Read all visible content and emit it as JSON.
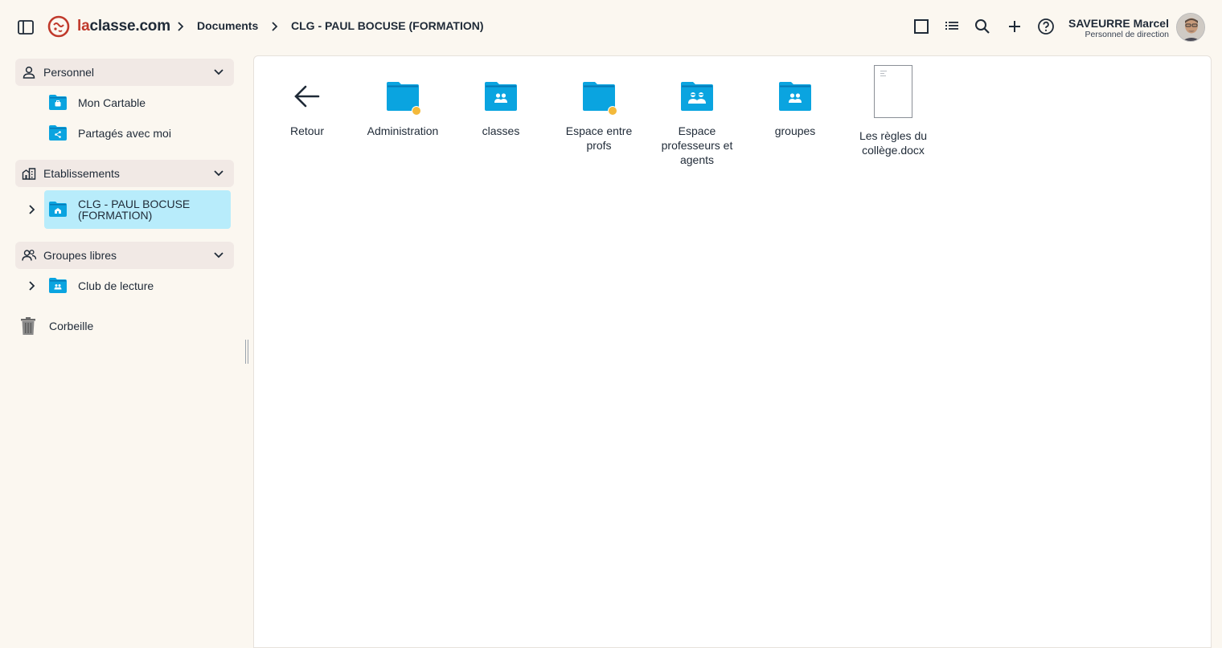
{
  "app": {
    "logo_text_accent": "la",
    "logo_text_rest": "classe.com",
    "brand_color": "#c0392b"
  },
  "breadcrumb": {
    "items": [
      "Documents",
      "CLG - PAUL BOCUSE (FORMATION)"
    ]
  },
  "toolbar": {
    "icons": [
      "grid-view-icon",
      "list-view-icon",
      "search-icon",
      "add-icon",
      "help-icon"
    ]
  },
  "user": {
    "name": "SAVEURRE Marcel",
    "role": "Personnel de direction"
  },
  "sidebar": {
    "personnel": {
      "label": "Personnel",
      "items": [
        {
          "label": "Mon Cartable",
          "icon": "briefcase-folder-icon"
        },
        {
          "label": "Partagés avec moi",
          "icon": "shared-folder-icon"
        }
      ]
    },
    "etablissements": {
      "label": "Etablissements",
      "items": [
        {
          "label": "CLG - PAUL BOCUSE (FORMATION)",
          "icon": "school-folder-icon",
          "selected": true
        }
      ]
    },
    "groupes_libres": {
      "label": "Groupes libres",
      "items": [
        {
          "label": "Club de lecture",
          "icon": "group-folder-icon"
        }
      ]
    },
    "trash": {
      "label": "Corbeille",
      "icon": "trash-icon"
    }
  },
  "main": {
    "items": [
      {
        "label": "Retour",
        "icon": "arrow-left-icon"
      },
      {
        "label": "Administration",
        "icon": "folder-icon",
        "badge": true
      },
      {
        "label": "classes",
        "icon": "group-folder-icon"
      },
      {
        "label": "Espace entre profs",
        "icon": "folder-icon",
        "badge": true
      },
      {
        "label": "Espace professeurs et agents",
        "icon": "teachers-folder-icon"
      },
      {
        "label": "groupes",
        "icon": "group-folder-icon"
      },
      {
        "label": "Les règles du collège.docx",
        "icon": "document-file-icon"
      }
    ]
  },
  "colors": {
    "folder": "#0aa4e0",
    "folder_dark": "#0779b5",
    "selected_bg": "#b8ecfb",
    "section_bg": "#f1e9e5",
    "badge": "#f3b93b",
    "page_bg": "#fbf7f0"
  }
}
